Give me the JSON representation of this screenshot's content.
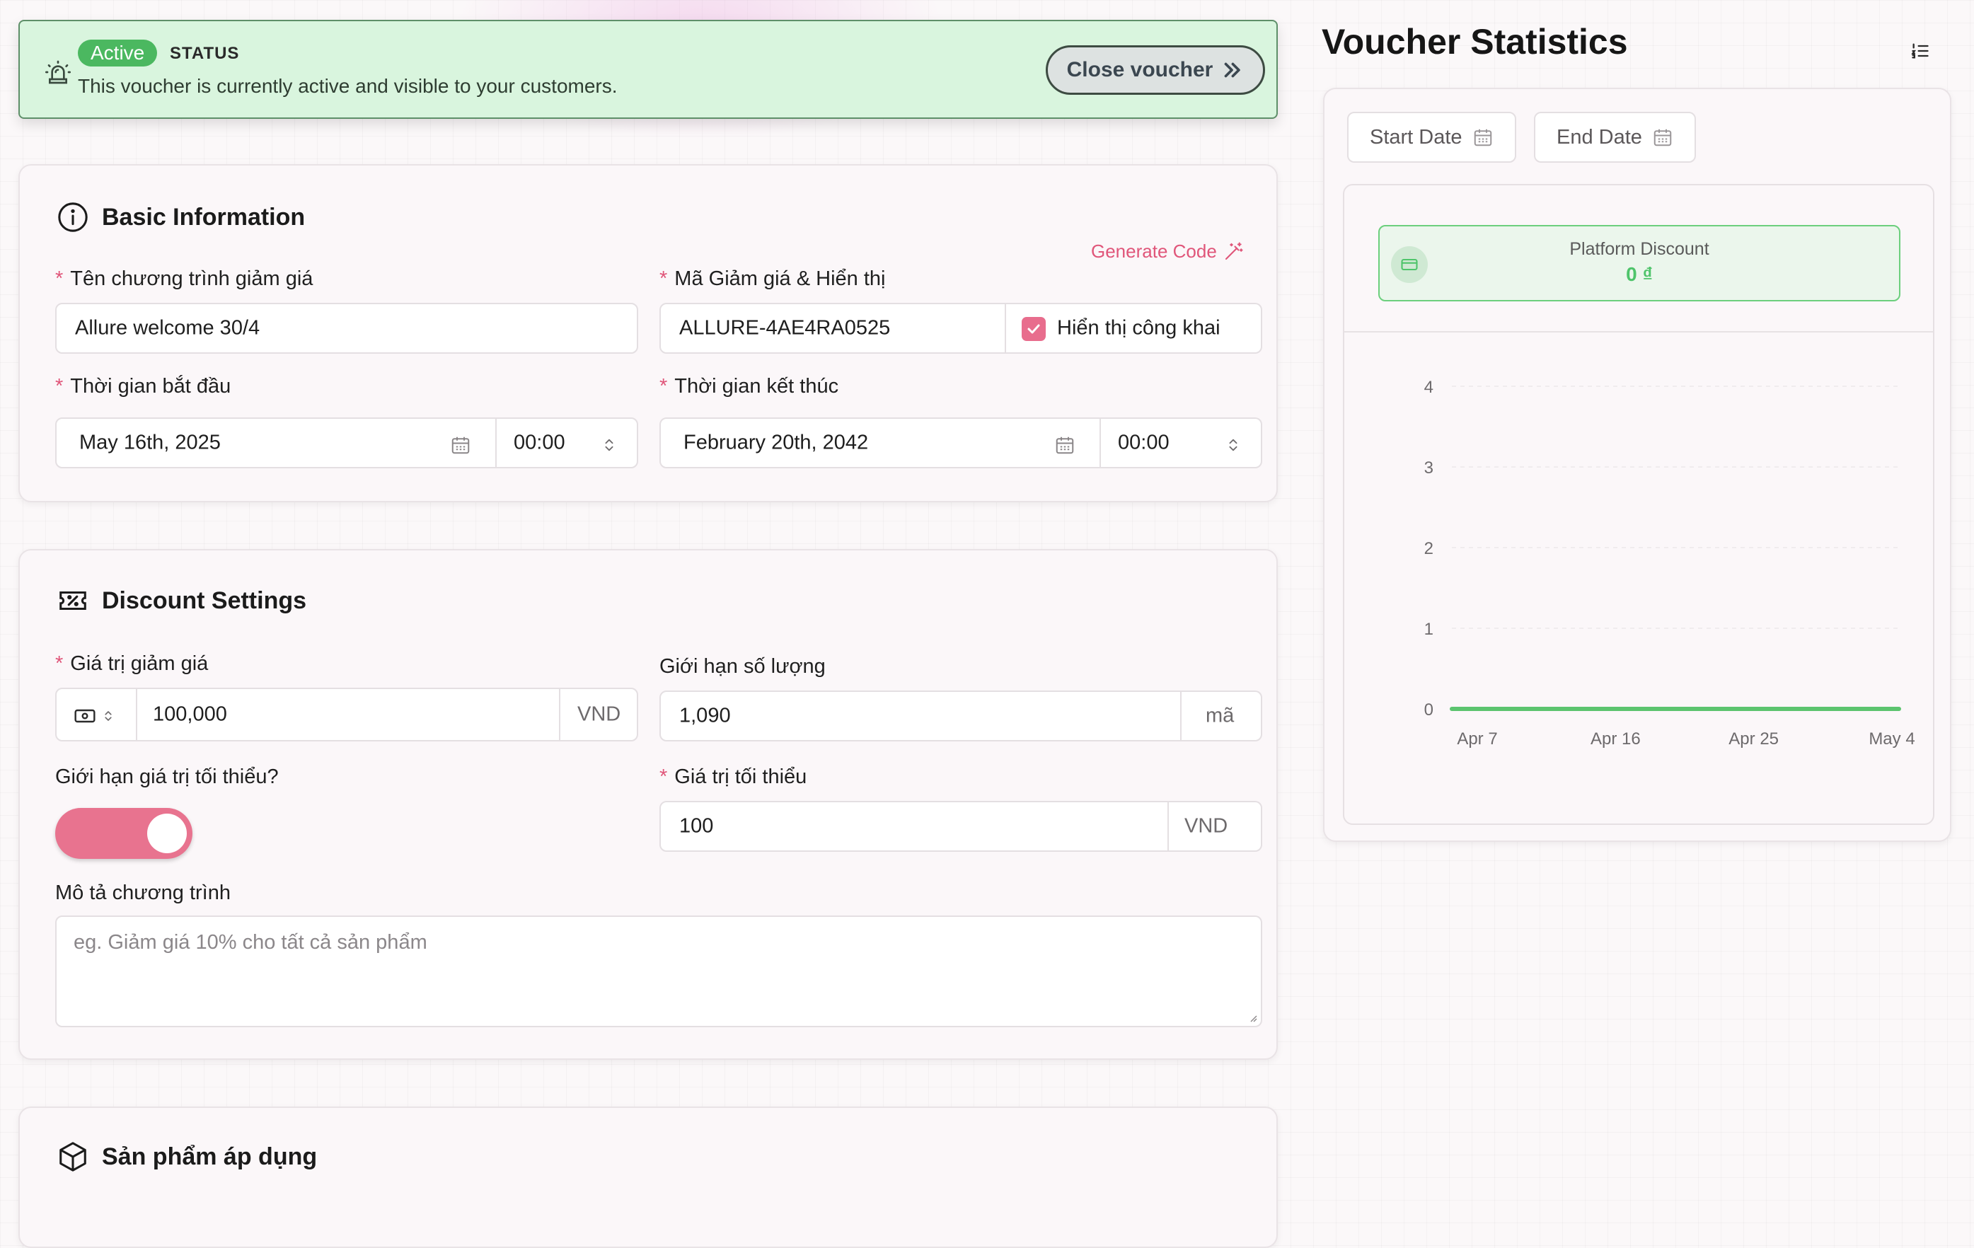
{
  "banner": {
    "badge": "Active",
    "label": "STATUS",
    "message": "This voucher is currently active and visible to your customers.",
    "close_button": "Close voucher",
    "colors": {
      "bg": "#d9f5de",
      "badge": "#4bb860"
    }
  },
  "basic": {
    "title": "Basic Information",
    "name_label": "Tên chương trình giảm giá",
    "name_value": "Allure welcome 30/4",
    "code_label": "Mã Giảm giá & Hiển thị",
    "generate_code": "Generate Code",
    "code_value": "ALLURE-4AE4RA0525",
    "public_label": "Hiển thị công khai",
    "public_checked": true,
    "start_label": "Thời gian bắt đầu",
    "start_date": "May 16th, 2025",
    "start_time": "00:00",
    "end_label": "Thời gian kết thúc",
    "end_date": "February 20th, 2042",
    "end_time": "00:00"
  },
  "discount": {
    "title": "Discount Settings",
    "value_label": "Giá trị giảm giá",
    "value": "100,000",
    "value_unit": "VND",
    "limit_label": "Giới hạn số lượng",
    "limit_value": "1,090",
    "limit_unit": "mã",
    "min_toggle_label": "Giới hạn giá trị tối thiểu?",
    "min_toggle_on": true,
    "min_label": "Giá trị tối thiểu",
    "min_value": "100",
    "min_unit": "VND",
    "desc_label": "Mô tả chương trình",
    "desc_placeholder": "eg. Giảm giá 10% cho tất cả sản phẩm"
  },
  "products": {
    "title": "Sản phẩm áp dụng"
  },
  "stats": {
    "title": "Voucher Statistics",
    "start_date": "Start Date",
    "end_date": "End Date",
    "platform_label": "Platform Discount",
    "platform_value": "0 ₫"
  },
  "chart_data": {
    "type": "line",
    "x": [
      "Apr 7",
      "Apr 16",
      "Apr 25",
      "May 4"
    ],
    "series": [
      {
        "values": [
          0,
          0,
          0,
          0
        ],
        "color": "#5cc46f"
      }
    ],
    "yticks": [
      0,
      1,
      2,
      3,
      4
    ],
    "ylim": [
      0,
      4
    ],
    "grid": true
  },
  "colors": {
    "accent": "#e0567a",
    "toggle": "#e8738f",
    "success": "#4ec46a"
  }
}
